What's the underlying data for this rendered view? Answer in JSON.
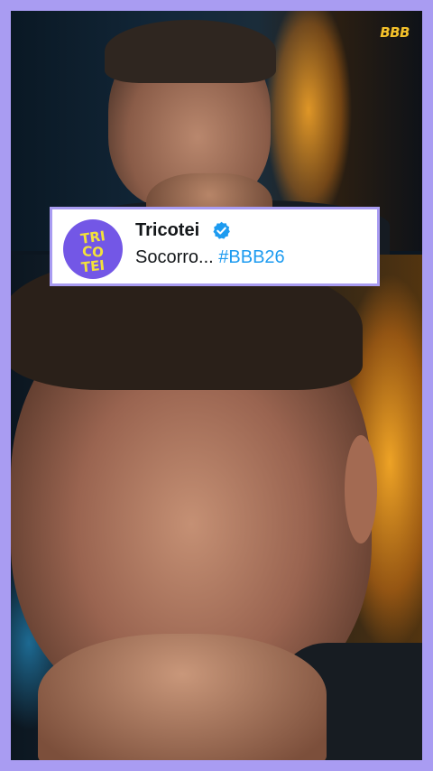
{
  "watermark": {
    "text": "BBB"
  },
  "tweet": {
    "display_name": "Tricotei",
    "avatar_logo_text": [
      "TRI",
      "CO",
      "TEI"
    ],
    "verified": true,
    "text_prefix": "Socorro...",
    "hashtag": "#BBB26"
  },
  "colors": {
    "border_lavender": "#a99cf2",
    "avatar_purple": "#7357e6",
    "avatar_text_yellow": "#f3e23a",
    "verified_blue": "#1d9bf0",
    "hashtag_blue": "#1d9bf0",
    "watermark_yellow": "#f3c02a"
  },
  "icons": {
    "verified": "verified-badge-icon",
    "avatar": "tricotei-logo-avatar"
  }
}
